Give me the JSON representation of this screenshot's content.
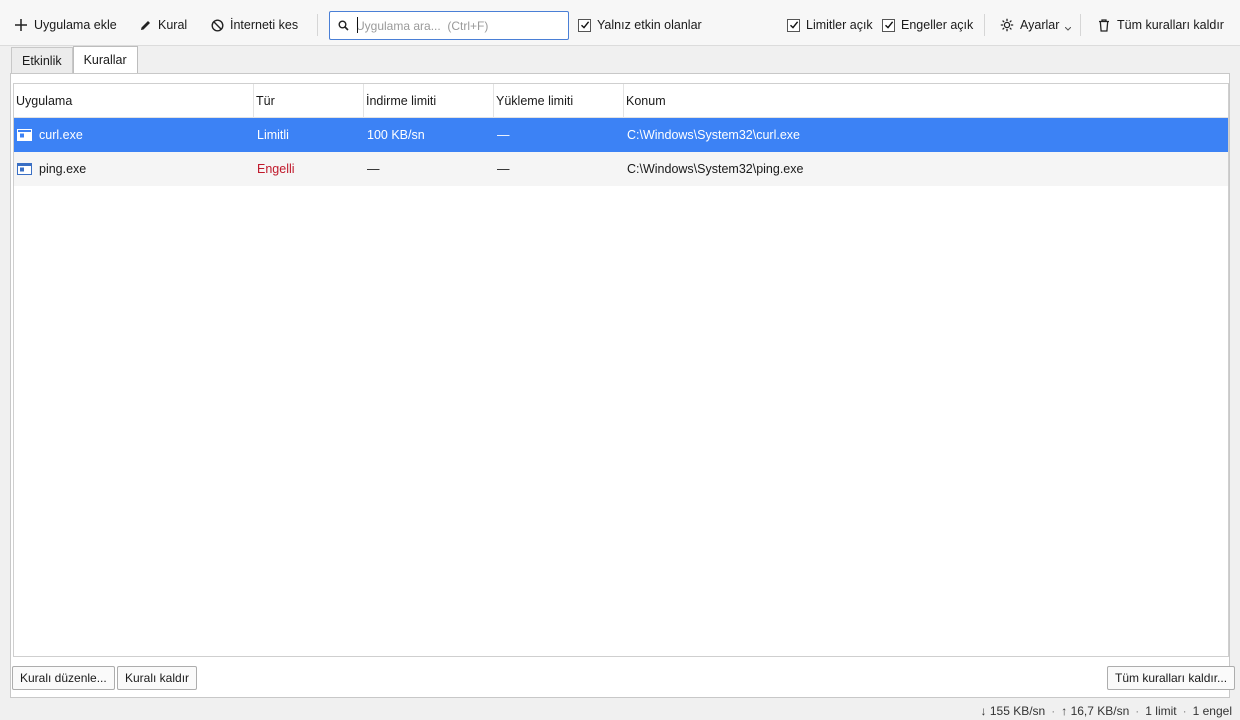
{
  "toolbar": {
    "add_app": "Uygulama ekle",
    "rule": "Kural",
    "cut_internet": "İnterneti kes",
    "search_placeholder": "Uygulama ara...  (Ctrl+F)",
    "only_active": "Yalnız etkin olanlar",
    "only_active_checked": true,
    "limits_on": "Limitler açık",
    "limits_on_checked": true,
    "blocks_on": "Engeller açık",
    "blocks_on_checked": true,
    "settings": "Ayarlar",
    "remove_all": "Tüm kuralları kaldır"
  },
  "tabs": [
    {
      "label": "Etkinlik",
      "active": false
    },
    {
      "label": "Kurallar",
      "active": true
    }
  ],
  "table": {
    "columns": [
      "Uygulama",
      "Tür",
      "İndirme limiti",
      "Yükleme limiti",
      "Konum"
    ],
    "rows": [
      {
        "app": "curl.exe",
        "type": "Limitli",
        "download": "100 KB/sn",
        "upload": "—",
        "path": "C:\\Windows\\System32\\curl.exe",
        "selected": true
      },
      {
        "app": "ping.exe",
        "type": "Engelli",
        "download": "—",
        "upload": "—",
        "path": "C:\\Windows\\System32\\ping.exe",
        "selected": false
      }
    ]
  },
  "buttons": {
    "edit_rule": "Kuralı düzenle...",
    "remove_rule": "Kuralı kaldır",
    "remove_all": "Tüm kuralları kaldır..."
  },
  "status": {
    "down": "↓ 155 KB/sn",
    "up": "↑ 16,7 KB/sn",
    "limits": "1 limit",
    "blocks": "1 engel",
    "sep": "·"
  },
  "colors": {
    "selection": "#3c82f5",
    "blocked_text": "#c0192b",
    "search_border": "#4a7fd6"
  }
}
